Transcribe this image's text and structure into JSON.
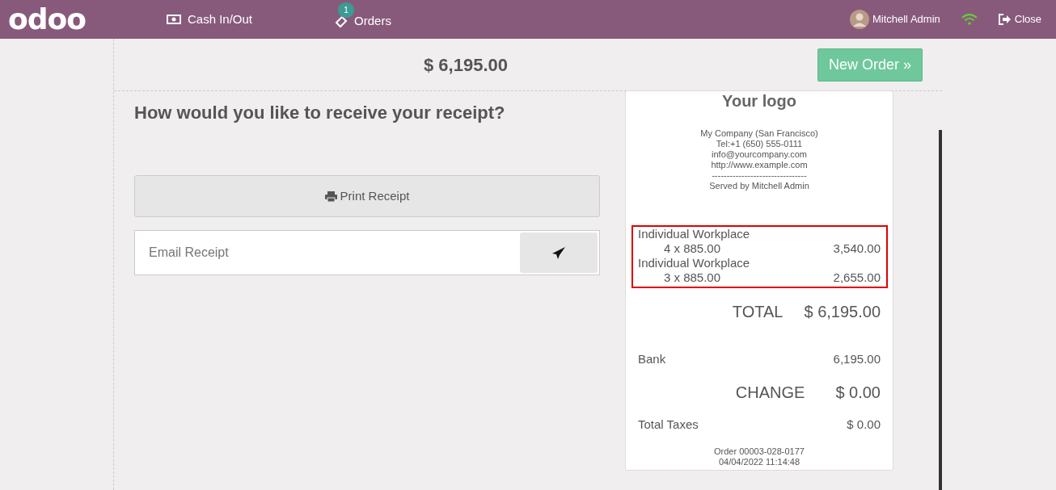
{
  "navbar": {
    "logo": "odoo",
    "items": [
      {
        "kind": "cash",
        "label": "Cash In/Out"
      },
      {
        "kind": "orders",
        "label": "Orders",
        "badge": "1"
      }
    ],
    "user": "Mitchell Admin",
    "close": "Close"
  },
  "top": {
    "amount": "$ 6,195.00",
    "new_order": "New Order »"
  },
  "receipt_options": {
    "heading": "How would you like to receive your receipt?",
    "print_button": "Print Receipt",
    "email": {
      "placeholder": "Email Receipt"
    }
  },
  "receipt": {
    "logo_text": "Your logo",
    "header_lines": [
      "My Company (San Francisco)",
      "Tel:+1 (650) 555-0111",
      "info@yourcompany.com",
      "http://www.example.com",
      "--------------------------------",
      "Served by Mitchell Admin"
    ],
    "lines_highlighted": true,
    "lines": [
      {
        "name": "Individual Workplace",
        "quantity": "4 x 885.00",
        "price": "3,540.00"
      },
      {
        "name": "Individual Workplace",
        "quantity": "3 x 885.00",
        "price": "2,655.00"
      }
    ],
    "total_label": "TOTAL",
    "total": "$ 6,195.00",
    "payments": [
      {
        "label": "Bank",
        "amount": "6,195.00"
      }
    ],
    "change_label": "CHANGE",
    "change": "$ 0.00",
    "taxes_label": "Total Taxes",
    "taxes": "$ 0.00",
    "footer_lines": [
      "Order 00003-028-0177",
      "04/04/2022 11:14:48"
    ]
  }
}
